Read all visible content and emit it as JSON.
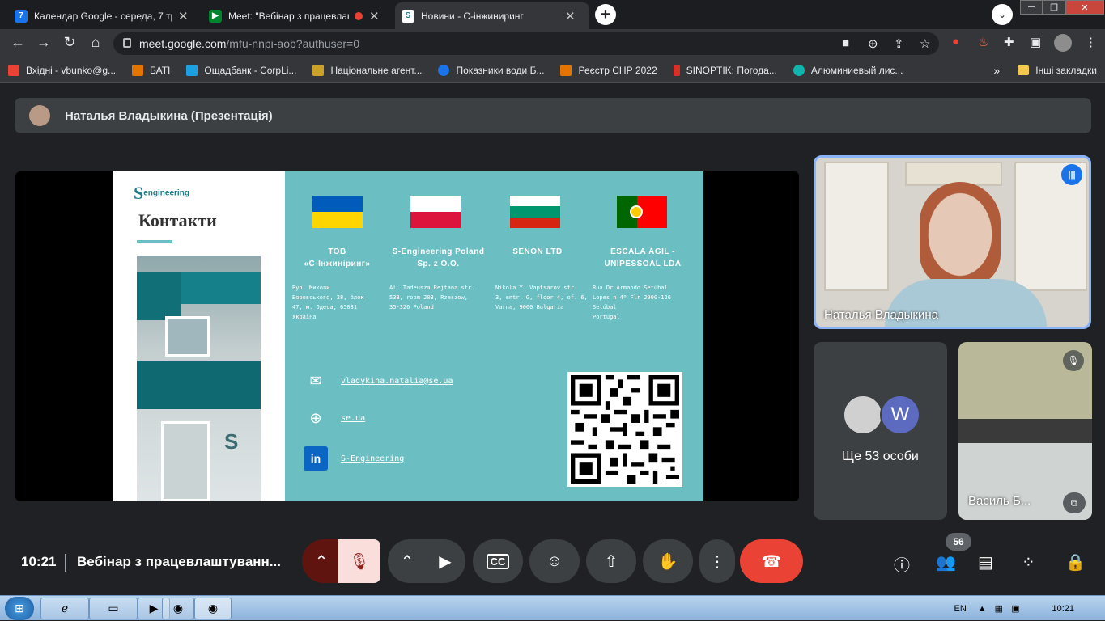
{
  "tabs": [
    {
      "title": "Календар Google - середа, 7 тра",
      "icon": "calendar-icon",
      "color": "#1a73e8",
      "glyph": "7"
    },
    {
      "title": "Meet: \"Вебінар з працевлашт",
      "icon": "meet-icon",
      "color": "#00832d",
      "glyph": "▶"
    },
    {
      "title": "Новини - С-інжиниринг",
      "icon": "s-engineering-icon",
      "color": "#ffffff",
      "glyph": "S"
    }
  ],
  "address": {
    "host": "meet.google.com",
    "path": "/mfu-nnpi-aob?authuser=0"
  },
  "bookmarks": [
    {
      "label": "Вхідні - vbunko@g...",
      "color": "#ea4335"
    },
    {
      "label": "БАТІ",
      "color": "#e37400"
    },
    {
      "label": "Ощадбанк - CorpLi...",
      "color": "#1ba1e2"
    },
    {
      "label": "Національне агент...",
      "color": "#c9a227"
    },
    {
      "label": "Показники води Б...",
      "color": "#1a73e8"
    },
    {
      "label": "Реєстр СНР 2022",
      "color": "#e37400"
    },
    {
      "label": "SINOPTIK: Погода...",
      "color": "#d93025"
    },
    {
      "label": "Алюминиевый лис...",
      "color": "#0fb5ae"
    }
  ],
  "bookmarks_more": "»",
  "other_bookmarks": "Інші закладки",
  "presenting": "Наталья Владыкина (Презентація)",
  "slide": {
    "logo_letter": "S",
    "logo_text": "engineering",
    "title": "Контакти",
    "building_sign": "S",
    "companies": [
      {
        "name_line1": "ТОВ",
        "name_line2": "«С-Інжиніринг»",
        "addr": [
          "Вул. Миколи",
          "Боровського, 28, блок",
          "47, м. Одеса, 65031",
          "Україна"
        ]
      },
      {
        "name_line1": "S-Engineering Poland",
        "name_line2": "Sp. z O.O.",
        "addr": [
          "Al. Tadeusza Rejtana str.",
          "53B, room 203, Rzeszow,",
          "35-326 Poland"
        ]
      },
      {
        "name_line1": "SENON LTD",
        "name_line2": "",
        "addr": [
          "Nikola Y. Vaptsarov str.",
          "3, entr. G, floor 4, of. 6,",
          "Varna, 9000 Bulgaria"
        ]
      },
      {
        "name_line1": "ESCALA ÁGIL -",
        "name_line2": "UNIPESSOAL LDA",
        "addr": [
          "Rua Dr Armando Setúbal",
          "Lopes n 4º Flr 2900-126",
          "Setúbal",
          "Portugal"
        ]
      }
    ],
    "email": "vladykina.natalia@se.ua",
    "website": "se.ua",
    "linkedin": "S-Engineering"
  },
  "tiles": {
    "main_name": "Наталья Владыкина",
    "more_label": "Ще 53 особи",
    "more_avatar_letter": "W",
    "room_name": "Василь Б..."
  },
  "controls": {
    "time": "10:21",
    "meeting_name": "Вебінар з працевлаштуванн...",
    "participants_count": "56"
  },
  "taskbar": {
    "lang": "EN",
    "time": "10:21"
  }
}
